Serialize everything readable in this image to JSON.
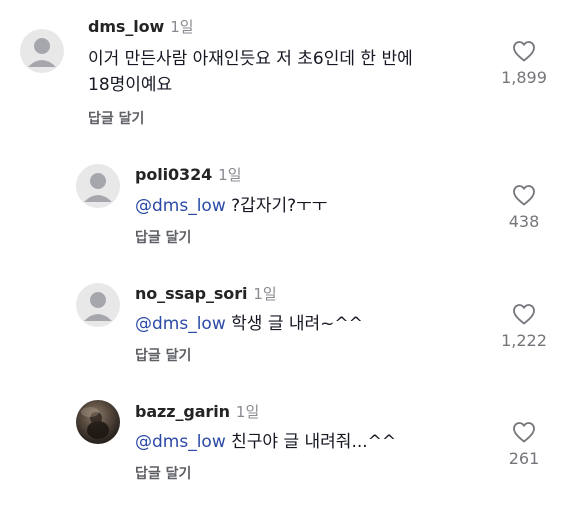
{
  "comments": [
    {
      "username": "dms_low",
      "time": "1일",
      "text_line1": "이거 만든사람 아재인듯요 저 초6인데 한 반에",
      "text_line2": "18명이예요",
      "reply_label": "답글 달기",
      "likes": "1,899",
      "avatar_icon": "default-avatar-icon"
    },
    {
      "username": "poli0324",
      "time": "1일",
      "mention": "@dms_low",
      "text": " ?갑자기?ㅜㅜ",
      "reply_label": "답글 달기",
      "likes": "438",
      "avatar_icon": "default-avatar-icon"
    },
    {
      "username": "no_ssap_sori",
      "time": "1일",
      "mention": "@dms_low",
      "text": " 학생 글 내려~^^",
      "reply_label": "답글 달기",
      "likes": "1,222",
      "avatar_icon": "default-avatar-icon"
    },
    {
      "username": "bazz_garin",
      "time": "1일",
      "mention": "@dms_low",
      "text": " 친구야 글 내려줘...^^",
      "reply_label": "답글 달기",
      "likes": "261",
      "avatar_icon": "photo-avatar"
    }
  ],
  "colors": {
    "mention": "#2b4aa6",
    "muted": "#8a8b91",
    "reply": "#5f6066",
    "avatar_bg": "#e8e8e8",
    "avatar_fg": "#a5a7ad"
  }
}
